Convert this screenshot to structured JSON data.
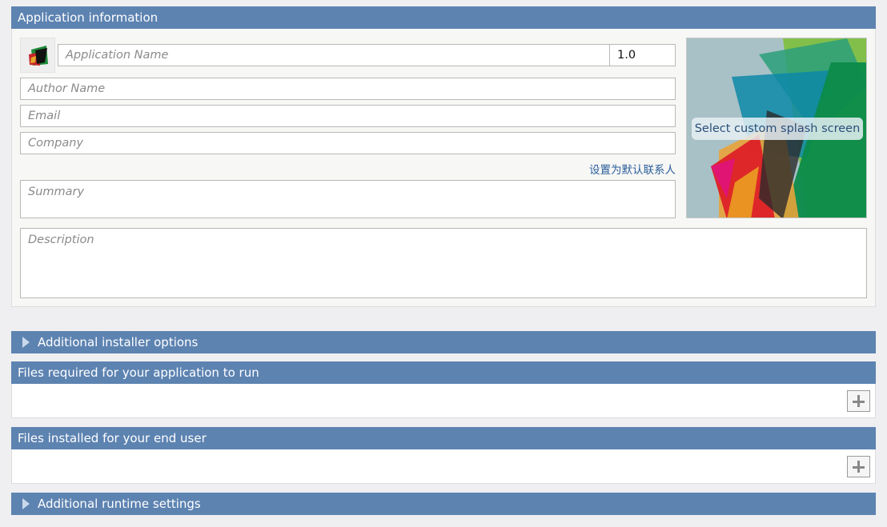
{
  "app_info": {
    "header": "Application information",
    "app_name_placeholder": "Application Name",
    "version_value": "1.0",
    "author_placeholder": "Author Name",
    "email_placeholder": "Email",
    "company_placeholder": "Company",
    "set_default_contact_link": "设置为默认联系人",
    "summary_placeholder": "Summary",
    "description_placeholder": "Description",
    "splash_label": "Select custom splash screen",
    "app_icon": "app-icon"
  },
  "sections": {
    "installer_options": "Additional installer options",
    "files_required": "Files required for your application to run",
    "files_installed": "Files installed for your end user",
    "runtime_settings": "Additional runtime settings"
  },
  "icons": {
    "expand": "triangle-right-icon",
    "add": "plus-icon"
  },
  "colors": {
    "header_bar": "#5d83b1",
    "link": "#2a5d9a"
  }
}
